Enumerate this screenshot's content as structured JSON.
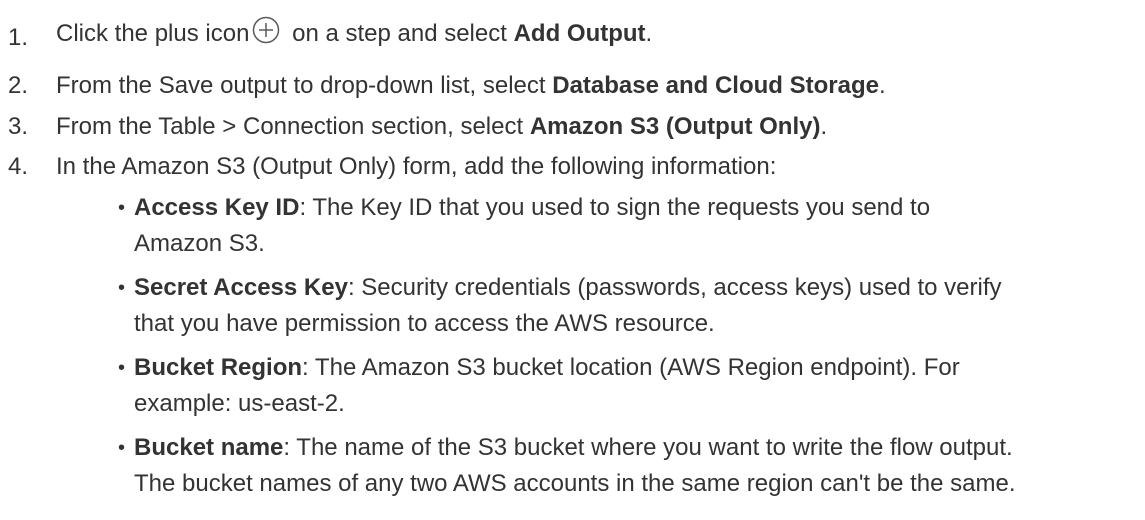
{
  "steps": [
    {
      "number": "1.",
      "before": "Click the plus icon",
      "icon": "plus-circle-icon",
      "after": " on a step and select ",
      "bold": "Add Output",
      "end": "."
    },
    {
      "number": "2.",
      "before": "From the Save output to drop-down list, select ",
      "bold": "Database and Cloud Storage",
      "end": "."
    },
    {
      "number": "3.",
      "before": "From the Table > Connection section, select ",
      "bold": "Amazon S3 (Output Only)",
      "end": "."
    },
    {
      "number": "4.",
      "text": "In the Amazon S3 (Output Only) form, add the following information:"
    }
  ],
  "fields": [
    {
      "term": "Access Key ID",
      "line1": ": The Key ID that you used to sign the requests you send to",
      "line2": "Amazon S3."
    },
    {
      "term": "Secret Access Key",
      "line1": ": Security credentials (passwords, access keys) used to verify",
      "line2": "that you have permission to access the AWS resource."
    },
    {
      "term": "Bucket Region",
      "line1": ": The Amazon S3 bucket location (AWS Region endpoint). For",
      "line2": "example: us-east-2."
    },
    {
      "term": "Bucket name",
      "line1": ": The name of the S3 bucket where you want to write the flow output.",
      "line2": "The bucket names of any two AWS accounts in the same region can't be the same."
    }
  ],
  "colors": {
    "text": "#333333",
    "icon_stroke": "#5a5a5a"
  }
}
